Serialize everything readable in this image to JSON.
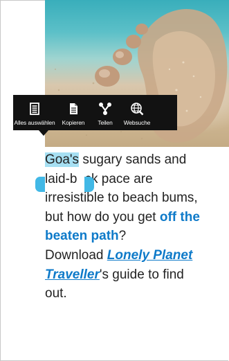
{
  "action_bar": {
    "items": [
      {
        "label": "Alles auswählen",
        "icon": "select-all-icon"
      },
      {
        "label": "Kopieren",
        "icon": "copy-icon"
      },
      {
        "label": "Teilen",
        "icon": "share-icon"
      },
      {
        "label": "Websuche",
        "icon": "web-search-icon"
      }
    ]
  },
  "article": {
    "line1_selected": "Goa's",
    "line1_rest": " sugary sands and",
    "line2_a": "laid-b",
    "line2_b": "ck pace are",
    "line3": "irresistible to beach bums,",
    "line4_a": "but how do you get ",
    "line4_link": "off the",
    "line5_link": "beaten path",
    "line5_rest": "?",
    "line6": "Download ",
    "line6_link": "Lonely Planet",
    "line7_link": "Traveller",
    "line7_rest": "'s guide to find",
    "line8": "out."
  },
  "colors": {
    "accent": "#0e7ac9",
    "selection": "#a6dff2",
    "handle": "#41b8e6",
    "toolbar": "#121212"
  }
}
